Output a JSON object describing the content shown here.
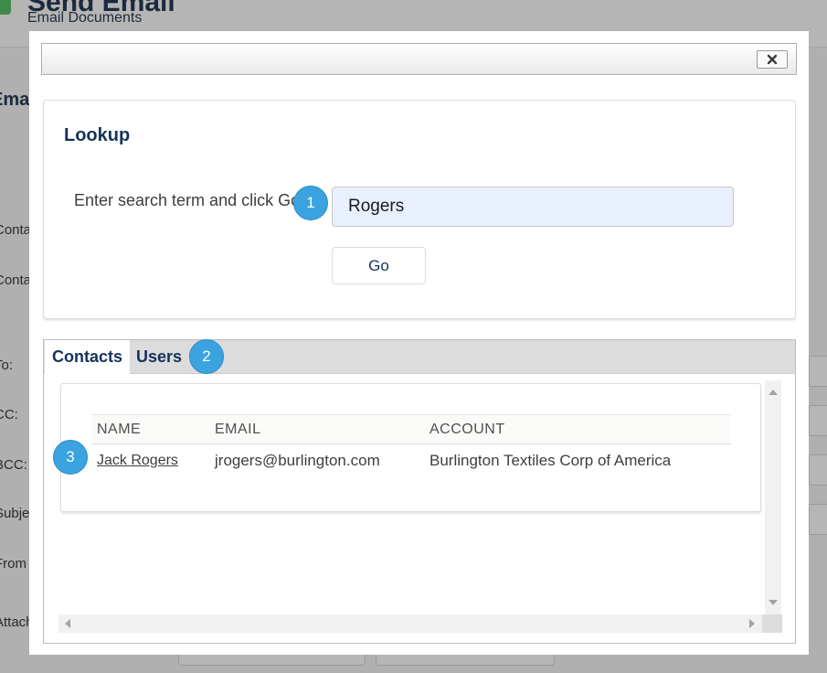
{
  "background": {
    "title": "Send Email",
    "subtitle": "Email Documents",
    "section": "Email",
    "labels": [
      "Contact",
      "Contact",
      "To:",
      "CC:",
      "BCC:",
      "Subject",
      "From A",
      "Attachm"
    ]
  },
  "modal": {
    "close_icon": "close-icon",
    "lookup": {
      "title": "Lookup",
      "search_label": "Enter search term and click Go",
      "search_value": "Rogers",
      "go_label": "Go"
    },
    "tabs": [
      {
        "label": "Contacts",
        "active": true
      },
      {
        "label": "Users",
        "active": false
      }
    ],
    "table": {
      "columns": [
        "NAME",
        "EMAIL",
        "ACCOUNT"
      ],
      "rows": [
        {
          "name": "Jack Rogers",
          "email": "jrogers@burlington.com",
          "account": "Burlington Textiles Corp of America"
        }
      ]
    },
    "badges": [
      "1",
      "2",
      "3"
    ]
  },
  "colors": {
    "badge": "#3aa3e0",
    "title_text": "#16325c",
    "input_bg": "#e8f0fe",
    "overlay": "#b0b0b0"
  }
}
